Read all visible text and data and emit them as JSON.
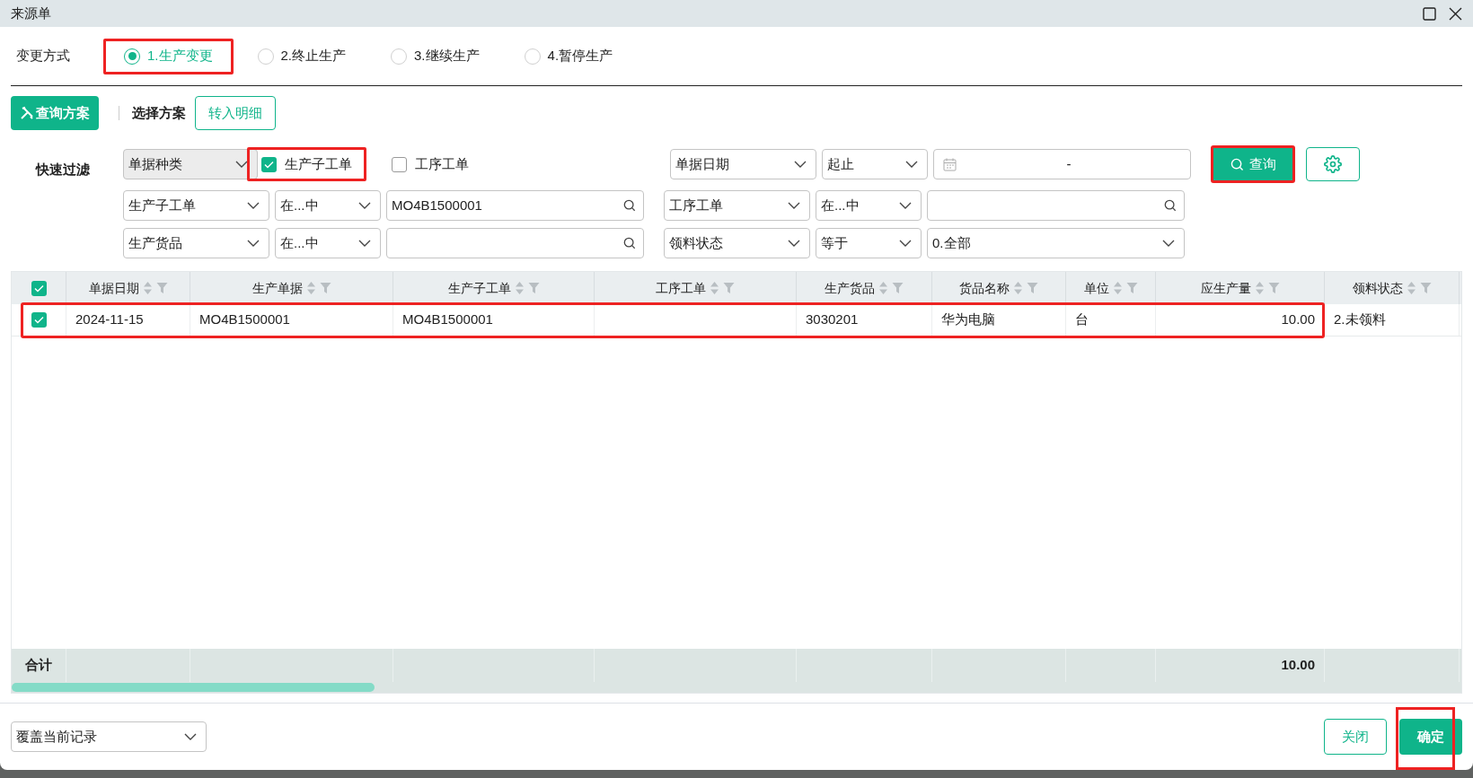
{
  "window": {
    "title": "来源单"
  },
  "change_mode": {
    "label": "变更方式",
    "options": [
      {
        "label": "1.生产变更",
        "selected": true,
        "highlighted": true
      },
      {
        "label": "2.终止生产",
        "selected": false,
        "highlighted": false
      },
      {
        "label": "3.继续生产",
        "selected": false,
        "highlighted": false
      },
      {
        "label": "4.暂停生产",
        "selected": false,
        "highlighted": false
      }
    ]
  },
  "toolbar": {
    "scheme_button": "查询方案",
    "select_scheme_label": "选择方案",
    "detail_button": "转入明细"
  },
  "quick_filter": {
    "label": "快速过滤",
    "doc_type": "单据种类",
    "doc_type_options": [
      {
        "label": "生产子工单",
        "checked": true,
        "highlighted": true
      },
      {
        "label": "工序工单",
        "checked": false,
        "highlighted": false
      }
    ],
    "date": {
      "field": "单据日期",
      "operator": "起止",
      "separator": "-"
    },
    "conditions": [
      {
        "field": "生产子工单",
        "operator": "在...中",
        "value": "MO4B1500001",
        "kind": "search"
      },
      {
        "field": "工序工单",
        "operator": "在...中",
        "kind": "search"
      },
      {
        "field": "生产货品",
        "operator": "在...中",
        "kind": "search"
      },
      {
        "field": "领料状态",
        "operator": "等于",
        "value": "0.全部",
        "kind": "select"
      }
    ],
    "query_button": {
      "label": "查询",
      "highlighted": true
    }
  },
  "table": {
    "header_checked": true,
    "columns": [
      {
        "label": "单据日期"
      },
      {
        "label": "生产单据"
      },
      {
        "label": "生产子工单"
      },
      {
        "label": "工序工单"
      },
      {
        "label": "生产货品"
      },
      {
        "label": "货品名称"
      },
      {
        "label": "单位"
      },
      {
        "label": "应生产量"
      },
      {
        "label": "领料状态"
      }
    ],
    "rows": [
      {
        "selected": true,
        "highlighted": true,
        "cells": [
          "2024-11-15",
          "MO4B1500001",
          "MO4B1500001",
          null,
          "3030201",
          "华为电脑",
          "台",
          "10.00",
          "2.未领料"
        ]
      }
    ],
    "footer": {
      "label": "合计",
      "cells": [
        null,
        null,
        null,
        null,
        null,
        null,
        null,
        "10.00",
        null
      ]
    }
  },
  "bottom": {
    "mode": "覆盖当前记录",
    "close_button": "关闭",
    "confirm_button": {
      "label": "确定",
      "highlighted": true
    }
  }
}
